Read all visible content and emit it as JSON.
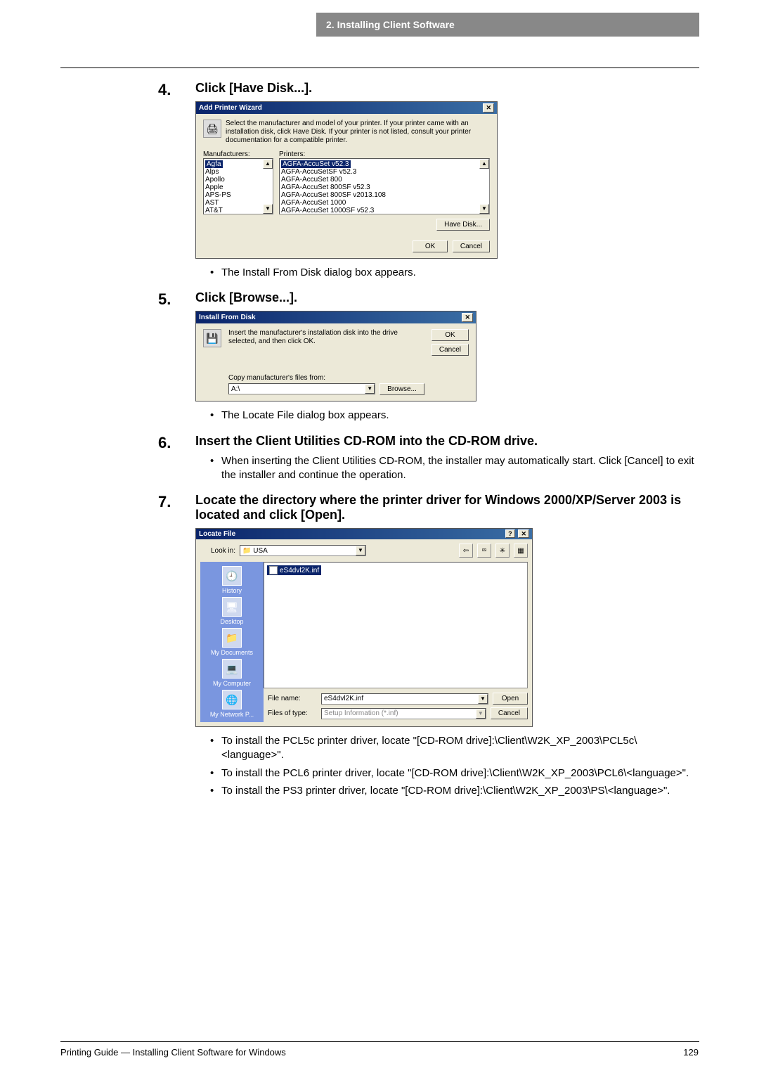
{
  "header": {
    "section_label": "2. Installing Client Software"
  },
  "steps": {
    "s4": {
      "num": "4.",
      "title": "Click [Have Disk...].",
      "note": "The Install From Disk dialog box appears.",
      "dialog": {
        "title": "Add Printer Wizard",
        "desc": "Select the manufacturer and model of your printer. If your printer came with an installation disk, click Have Disk. If your printer is not listed, consult your printer documentation for a compatible printer.",
        "mfr_label": "Manufacturers:",
        "prn_label": "Printers:",
        "manufacturers": [
          "Agfa",
          "Alps",
          "Apollo",
          "Apple",
          "APS-PS",
          "AST",
          "AT&T"
        ],
        "printers": [
          "AGFA-AccuSet v52.3",
          "AGFA-AccuSetSF v52.3",
          "AGFA-AccuSet 800",
          "AGFA-AccuSet 800SF v52.3",
          "AGFA-AccuSet 800SF v2013.108",
          "AGFA-AccuSet 1000",
          "AGFA-AccuSet 1000SF v52.3"
        ],
        "have_disk": "Have Disk...",
        "ok": "OK",
        "cancel": "Cancel"
      }
    },
    "s5": {
      "num": "5.",
      "title": "Click [Browse...].",
      "note": "The Locate File dialog box appears.",
      "dialog": {
        "title": "Install From Disk",
        "desc": "Insert the manufacturer's installation disk into the drive selected, and then click OK.",
        "ok": "OK",
        "cancel": "Cancel",
        "copy_label": "Copy manufacturer's files from:",
        "path": "A:\\",
        "browse": "Browse..."
      }
    },
    "s6": {
      "num": "6.",
      "title": "Insert the Client Utilities CD-ROM into the CD-ROM drive.",
      "note": "When inserting the Client Utilities CD-ROM, the installer may automatically start. Click [Cancel] to exit the installer and continue the operation."
    },
    "s7": {
      "num": "7.",
      "title": "Locate the directory where the printer driver for Windows 2000/XP/Server 2003 is located and click [Open].",
      "dialog": {
        "title": "Locate File",
        "look_in_label": "Look in:",
        "look_in_value": "USA",
        "places": [
          "History",
          "Desktop",
          "My Documents",
          "My Computer",
          "My Network P..."
        ],
        "file_selected": "eS4dvl2K.inf",
        "file_name_label": "File name:",
        "file_name_value": "eS4dvl2K.inf",
        "file_type_label": "Files of type:",
        "file_type_value": "Setup Information (*.inf)",
        "open": "Open",
        "cancel": "Cancel"
      },
      "bullets": [
        "To install the PCL5c printer driver, locate \"[CD-ROM drive]:\\Client\\W2K_XP_2003\\PCL5c\\<language>\".",
        "To install the PCL6 printer driver, locate \"[CD-ROM drive]:\\Client\\W2K_XP_2003\\PCL6\\<language>\".",
        "To install the PS3 printer driver, locate \"[CD-ROM drive]:\\Client\\W2K_XP_2003\\PS\\<language>\"."
      ]
    }
  },
  "footer": {
    "left": "Printing Guide — Installing Client Software for Windows",
    "right": "129"
  }
}
